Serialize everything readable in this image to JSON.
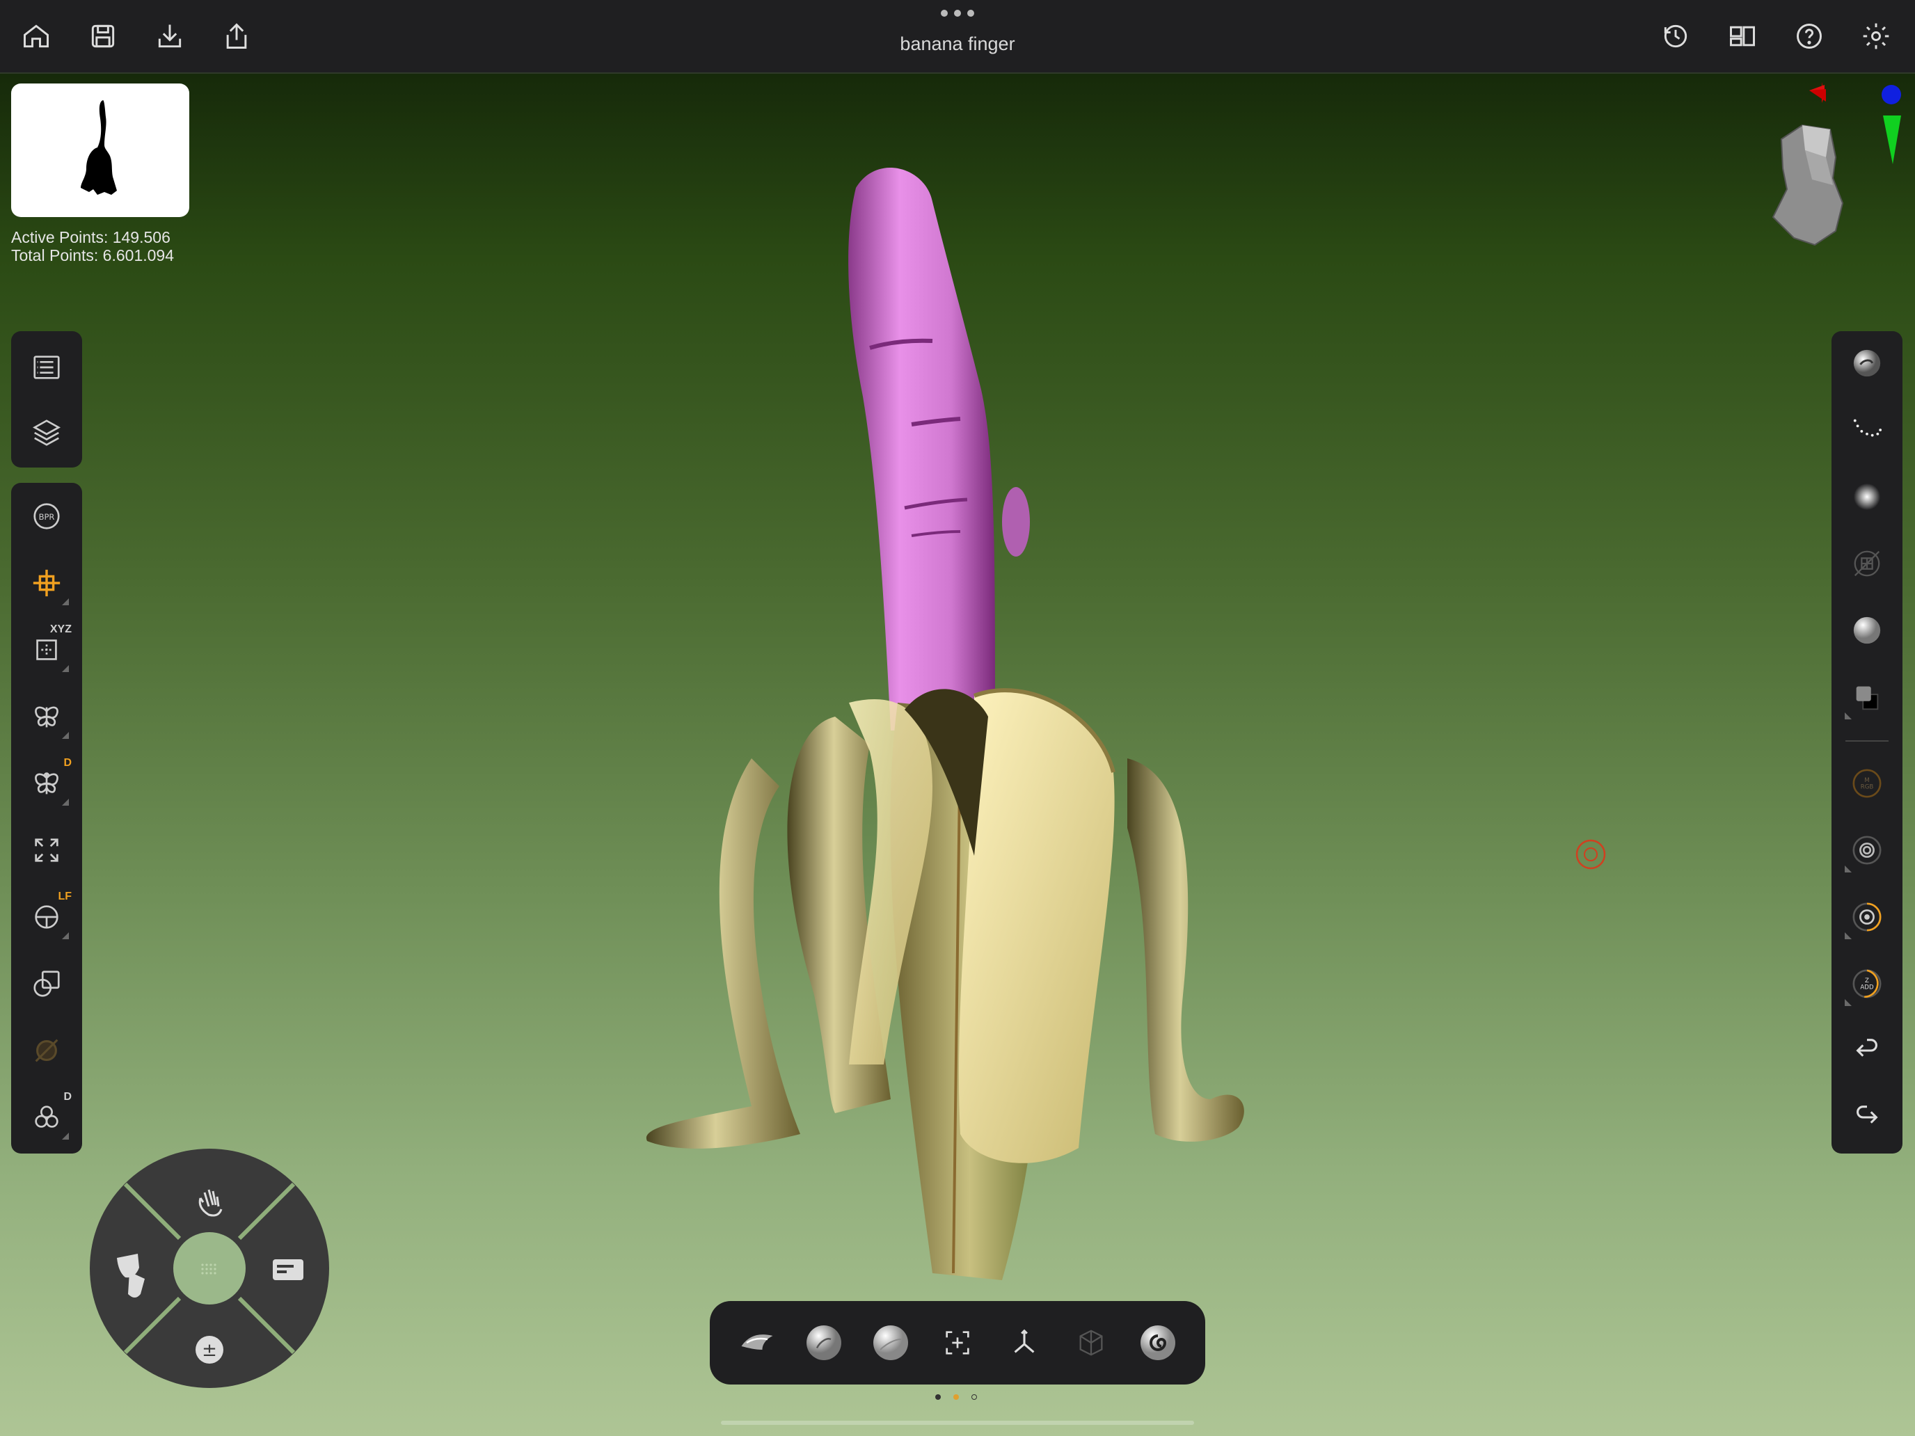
{
  "app": {
    "document_title": "banana finger"
  },
  "topbar": {
    "left_icons": [
      "home-icon",
      "save-icon",
      "import-icon",
      "share-icon"
    ],
    "right_icons": [
      "history-icon",
      "layout-icon",
      "help-icon",
      "settings-icon"
    ]
  },
  "stats": {
    "active_points": "Active Points: 149.506",
    "total_points": "Total Points: 6.601.094"
  },
  "left_panel_top": [
    "tool-palette-icon",
    "subtools-icon"
  ],
  "left_panel_main": [
    {
      "icon": "bpr-icon",
      "label": "BPR"
    },
    {
      "icon": "gizmo-icon",
      "badge": ""
    },
    {
      "icon": "frame-icon",
      "badge": "XYZ"
    },
    {
      "icon": "symmetry-icon",
      "badge": ""
    },
    {
      "icon": "dynamic-symmetry-icon",
      "badge": "D"
    },
    {
      "icon": "frame-fit-icon",
      "badge": ""
    },
    {
      "icon": "perspective-icon",
      "badge": "LF"
    },
    {
      "icon": "polyframe-icon",
      "badge": ""
    },
    {
      "icon": "transp-icon",
      "badge": ""
    },
    {
      "icon": "solo-icon",
      "badge": "D"
    }
  ],
  "right_panel": [
    {
      "icon": "material-icon"
    },
    {
      "icon": "stroke-icon"
    },
    {
      "icon": "alpha-icon"
    },
    {
      "icon": "texture-icon"
    },
    {
      "icon": "sphere-material-icon"
    },
    {
      "icon": "color-swatch-icon"
    },
    {
      "icon": "m-rgb-icon",
      "label": "M\nRGB"
    },
    {
      "icon": "draw-size-icon"
    },
    {
      "icon": "focal-icon"
    },
    {
      "icon": "zadd-icon",
      "label": "Z\nADD"
    },
    {
      "icon": "undo-icon"
    },
    {
      "icon": "redo-icon"
    }
  ],
  "bottom_toolbar": [
    "standard-brush-icon",
    "clay-brush-icon",
    "move-brush-icon",
    "select-icon",
    "transpose-icon",
    "dynamesh-icon",
    "spiral-icon"
  ],
  "pager": {
    "count": 3,
    "active": 1
  },
  "dpad": {
    "up": "gesture-icon",
    "left": "masks-icon",
    "right": "menu-icon",
    "down": "plus-minus-icon",
    "center": "grid-icon"
  },
  "colors": {
    "topbar": "#1f1f21",
    "accent": "#f0a020",
    "finger": "#d98ad9",
    "banana_peel": "#e0d8a0"
  }
}
